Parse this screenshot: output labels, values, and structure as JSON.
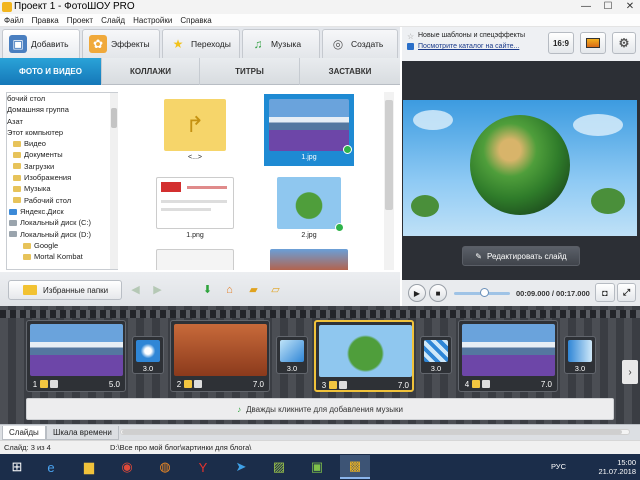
{
  "window": {
    "title": "Проект 1 - ФотоШОУ PRO",
    "minimize": "—",
    "maximize": "☐",
    "close": "✕"
  },
  "menu": [
    "Файл",
    "Правка",
    "Проект",
    "Слайд",
    "Настройки",
    "Справка"
  ],
  "tabs": [
    "Добавить",
    "Эффекты",
    "Переходы",
    "Музыка",
    "Создать"
  ],
  "subtabs": [
    "ФОТО И ВИДЕО",
    "КОЛЛАЖИ",
    "ТИТРЫ",
    "ЗАСТАВКИ"
  ],
  "tree": [
    "бочий стол",
    "Домашняя группа",
    "Азат",
    "Этот компьютер",
    "Видео",
    "Документы",
    "Загрузки",
    "Изображения",
    "Музыка",
    "Рабочий стол",
    "Яндекс.Диск",
    "Локальный диск (C:)",
    "Локальный диск (D:)",
    "Google",
    "Mortal Kombat"
  ],
  "files": [
    {
      "name": "<...>"
    },
    {
      "name": "1.jpg"
    },
    {
      "name": "1.png"
    },
    {
      "name": "2.jpg"
    },
    {
      "name": ""
    },
    {
      "name": ""
    }
  ],
  "left_bottom": {
    "favorites": "Избранные папки"
  },
  "right": {
    "news_link": "Новые шаблоны и спецэффекты",
    "catalog_link": "Посмотрите каталог на сайте...",
    "aspect": "16:9",
    "edit_slide": "Редактировать слайд",
    "time": "00:09.000 / 00:17.000"
  },
  "slides": [
    {
      "num": "1",
      "dur": "5.0"
    },
    {
      "num": "2",
      "dur": "7.0"
    },
    {
      "num": "3",
      "dur": "7.0"
    },
    {
      "num": "4",
      "dur": "7.0"
    }
  ],
  "transitions": [
    "3.0",
    "3.0",
    "3.0",
    "3.0"
  ],
  "music_hint": "Дважды кликните для добавления музыки",
  "bottom_tabs": [
    "Слайды",
    "Шкала времени"
  ],
  "status": {
    "slide": "Слайд: 3 из 4",
    "path": "D:\\Все про мой блог\\картинки для блога\\"
  },
  "tray": {
    "lang": "РУС",
    "time": "15:00",
    "date": "21.07.2018"
  }
}
